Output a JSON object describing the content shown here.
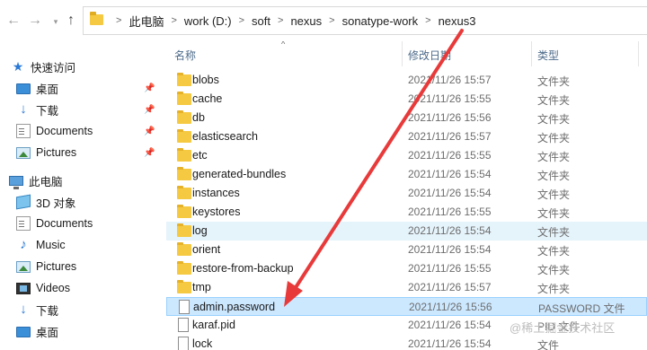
{
  "address": {
    "crumbs": [
      "此电脑",
      "work (D:)",
      "soft",
      "nexus",
      "sonatype-work",
      "nexus3"
    ]
  },
  "nav": {
    "icons": {
      "back": "back-arrow-icon",
      "forward": "forward-arrow-icon",
      "recent": "chevron-down-icon",
      "up": "up-arrow-icon"
    },
    "quick_access": "快速访问",
    "quick_items": [
      {
        "label": "桌面",
        "icon": "desktop-icon"
      },
      {
        "label": "下载",
        "icon": "download-icon"
      },
      {
        "label": "Documents",
        "icon": "document-icon"
      },
      {
        "label": "Pictures",
        "icon": "pictures-icon"
      }
    ],
    "this_pc": "此电脑",
    "pc_items": [
      {
        "label": "3D 对象",
        "icon": "3d-objects-icon"
      },
      {
        "label": "Documents",
        "icon": "document-icon"
      },
      {
        "label": "Music",
        "icon": "music-icon"
      },
      {
        "label": "Pictures",
        "icon": "pictures-icon"
      },
      {
        "label": "Videos",
        "icon": "videos-icon"
      },
      {
        "label": "下载",
        "icon": "download-icon"
      },
      {
        "label": "桌面",
        "icon": "desktop-icon"
      }
    ]
  },
  "columns": {
    "name": "名称",
    "date": "修改日期",
    "type": "类型"
  },
  "files": [
    {
      "name": "blobs",
      "date": "2021/11/26 15:57",
      "type": "文件夹",
      "kind": "folder"
    },
    {
      "name": "cache",
      "date": "2021/11/26 15:55",
      "type": "文件夹",
      "kind": "folder"
    },
    {
      "name": "db",
      "date": "2021/11/26 15:56",
      "type": "文件夹",
      "kind": "folder"
    },
    {
      "name": "elasticsearch",
      "date": "2021/11/26 15:57",
      "type": "文件夹",
      "kind": "folder"
    },
    {
      "name": "etc",
      "date": "2021/11/26 15:55",
      "type": "文件夹",
      "kind": "folder"
    },
    {
      "name": "generated-bundles",
      "date": "2021/11/26 15:54",
      "type": "文件夹",
      "kind": "folder"
    },
    {
      "name": "instances",
      "date": "2021/11/26 15:54",
      "type": "文件夹",
      "kind": "folder"
    },
    {
      "name": "keystores",
      "date": "2021/11/26 15:55",
      "type": "文件夹",
      "kind": "folder"
    },
    {
      "name": "log",
      "date": "2021/11/26 15:54",
      "type": "文件夹",
      "kind": "folder",
      "state": "hover"
    },
    {
      "name": "orient",
      "date": "2021/11/26 15:54",
      "type": "文件夹",
      "kind": "folder"
    },
    {
      "name": "restore-from-backup",
      "date": "2021/11/26 15:55",
      "type": "文件夹",
      "kind": "folder"
    },
    {
      "name": "tmp",
      "date": "2021/11/26 15:57",
      "type": "文件夹",
      "kind": "folder"
    },
    {
      "name": "admin.password",
      "date": "2021/11/26 15:56",
      "type": "PASSWORD 文件",
      "kind": "file",
      "state": "selected"
    },
    {
      "name": "karaf.pid",
      "date": "2021/11/26 15:54",
      "type": "PID 文件",
      "kind": "file"
    },
    {
      "name": "lock",
      "date": "2021/11/26 15:54",
      "type": "文件",
      "kind": "file"
    }
  ],
  "colors": {
    "annotation_arrow": "#e83a3a",
    "selection": "#cce8ff",
    "hover": "#e5f3fb"
  },
  "watermark": "@稀土掘金技术社区"
}
